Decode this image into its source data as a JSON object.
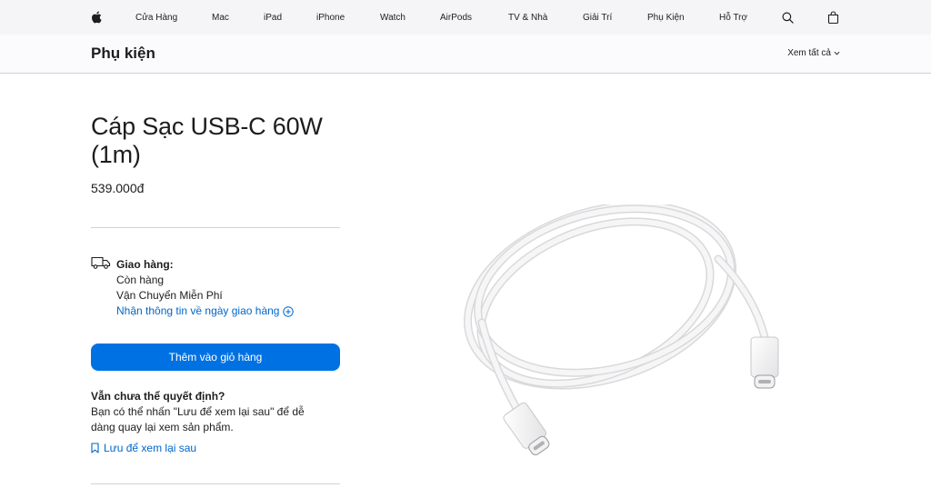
{
  "nav": {
    "items": [
      "Cửa Hàng",
      "Mac",
      "iPad",
      "iPhone",
      "Watch",
      "AirPods",
      "TV & Nhà",
      "Giải Trí",
      "Phụ Kiện",
      "Hỗ Trợ"
    ]
  },
  "subnav": {
    "title": "Phụ kiện",
    "see_all": "Xem tất cả"
  },
  "product": {
    "title": "Cáp Sạc USB-C 60W (1m)",
    "price": "539.000đ"
  },
  "delivery": {
    "label": "Giao hàng:",
    "stock": "Còn hàng",
    "shipping": "Vận Chuyển Miễn Phí",
    "link": "Nhận thông tin về ngày giao hàng"
  },
  "cart": {
    "add_label": "Thêm vào giỏ hàng"
  },
  "undecided": {
    "heading": "Vẫn chưa thể quyết định?",
    "text": "Bạn có thể nhấn \"Lưu để xem lại sau\" để dễ dàng quay lại xem sản phẩm.",
    "save_label": "Lưu để xem lại sau"
  },
  "colors": {
    "accent": "#0071e3",
    "link": "#0066cc",
    "nav_bg": "#f5f5f7"
  }
}
